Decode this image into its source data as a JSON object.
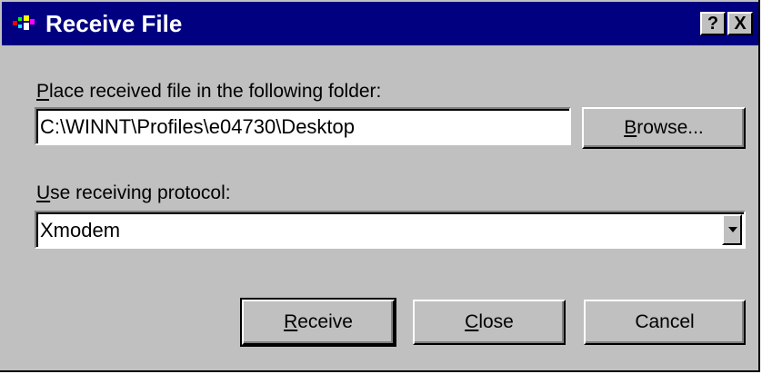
{
  "window": {
    "title": "Receive File",
    "help_label": "?",
    "close_label": "X"
  },
  "folder": {
    "label": "Place received file in the following folder:",
    "label_accel": "P",
    "label_rest": "lace received file in the following folder:",
    "value": "C:\\WINNT\\Profiles\\e04730\\Desktop",
    "browse_accel": "B",
    "browse_rest": "rowse..."
  },
  "protocol": {
    "label_accel": "U",
    "label_rest": "se receiving protocol:",
    "selected": "Xmodem"
  },
  "buttons": {
    "receive_accel": "R",
    "receive_rest": "eceive",
    "close_accel": "C",
    "close_rest": "lose",
    "cancel": "Cancel"
  },
  "colors": {
    "titlebar": "#000080",
    "face": "#c0c0c0"
  },
  "icons": {
    "app": "modem-icon",
    "dropdown": "chevron-down-icon"
  }
}
